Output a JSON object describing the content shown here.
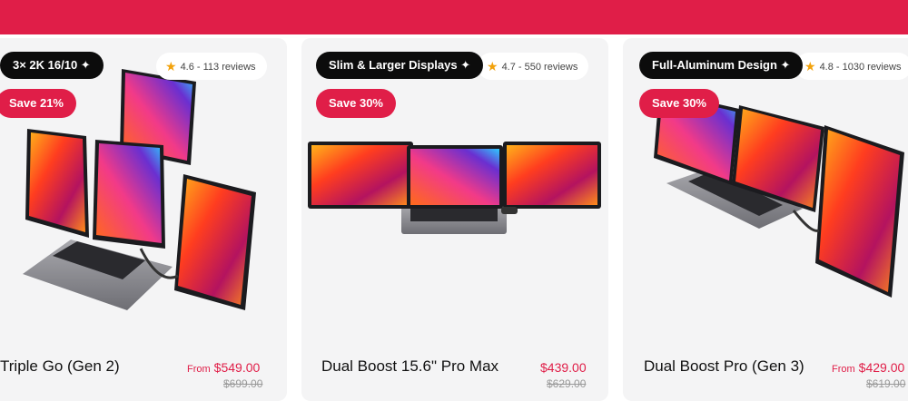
{
  "header": {
    "bar_color": "#e01e48"
  },
  "products": [
    {
      "tag": "3× 2K 16/10 ✦",
      "rating": "4.6 - 113 reviews",
      "save": "Save 21%",
      "name": "Triple Go (Gen 2)",
      "from": "From",
      "price": "$549.00",
      "old_price": "$699.00"
    },
    {
      "tag": "Slim & Larger Displays ✦",
      "rating": "4.7 - 550 reviews",
      "save": "Save 30%",
      "name": "Dual Boost 15.6\" Pro Max",
      "from": "",
      "price": "$439.00",
      "old_price": "$629.00"
    },
    {
      "tag": "Full-Aluminum Design ✦",
      "rating": "4.8 - 1030 reviews",
      "save": "Save 30%",
      "name": "Dual Boost Pro (Gen 3)",
      "from": "From",
      "price": "$429.00",
      "old_price": "$619.00"
    }
  ],
  "icons": {
    "rating": "star-icon"
  },
  "colors": {
    "accent": "#e01e48",
    "badge_dark": "#0c0c0c",
    "star": "#f2a20c"
  }
}
